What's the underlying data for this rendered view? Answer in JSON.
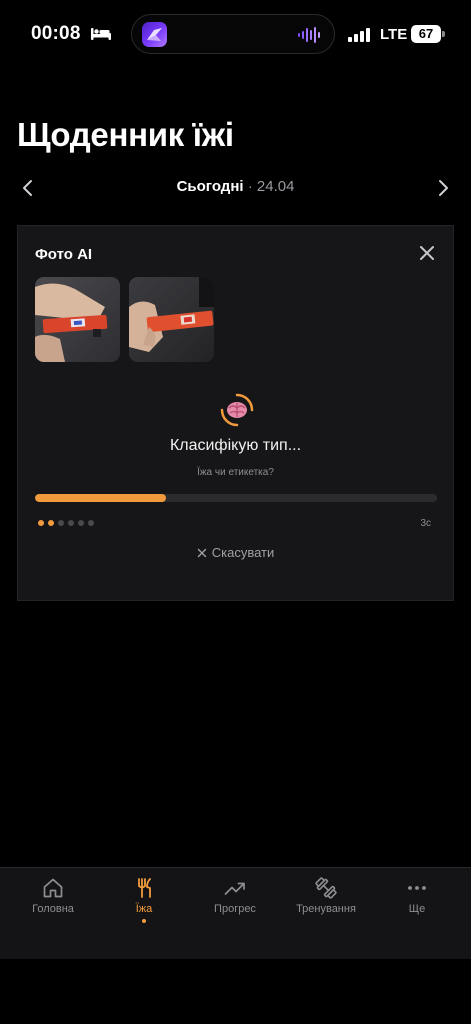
{
  "status_bar": {
    "time": "00:08",
    "network": "LTE",
    "battery": "67"
  },
  "header": {
    "title": "Щоденник їжі"
  },
  "date_nav": {
    "today": "Сьогодні",
    "separator": " · ",
    "date": "24.04"
  },
  "ai_card": {
    "title": "Фото AI",
    "status_title": "Класифікую тип...",
    "status_subtitle": "Їжа чи етикетка?",
    "progress": 0.325,
    "steps_total": 6,
    "steps_active": 2,
    "timer": "3с",
    "cancel_label": "Скасувати"
  },
  "tabs": [
    {
      "label": "Головна",
      "icon": "home-icon",
      "active": false
    },
    {
      "label": "Їжа",
      "icon": "fork-knife-icon",
      "active": true
    },
    {
      "label": "Прогрес",
      "icon": "trend-up-icon",
      "active": false
    },
    {
      "label": "Тренування",
      "icon": "dumbbell-icon",
      "active": false
    },
    {
      "label": "Ще",
      "icon": "more-icon",
      "active": false
    }
  ],
  "colors": {
    "accent": "#f29b3d",
    "background": "#000000",
    "card": "#161618"
  }
}
